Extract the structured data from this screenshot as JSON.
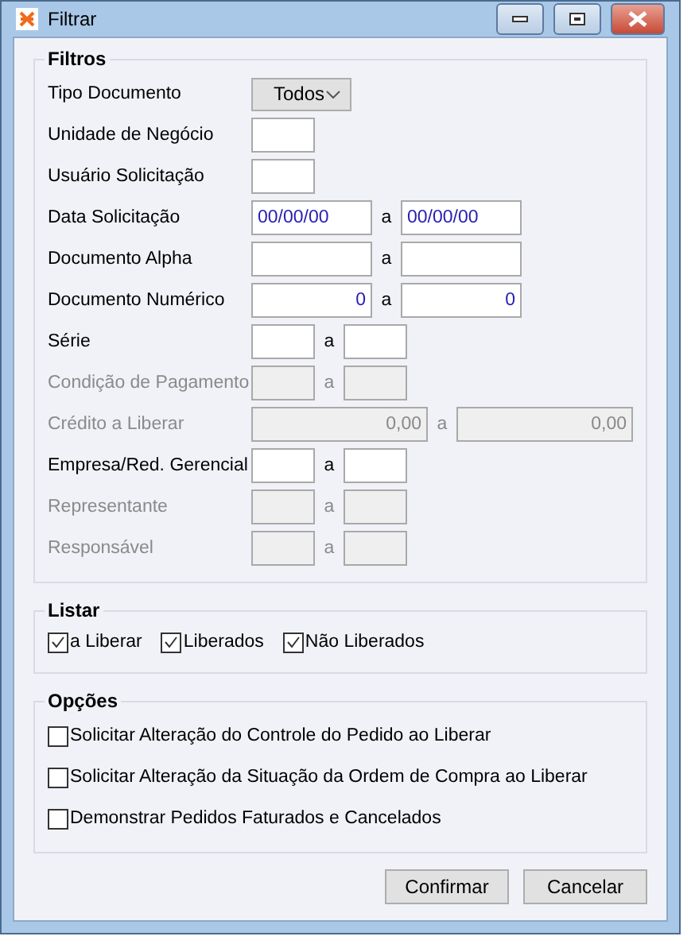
{
  "window": {
    "title": "Filtrar"
  },
  "filters": {
    "title": "Filtros",
    "rows": [
      {
        "label": "Tipo Documento",
        "kind": "select",
        "disabled": false,
        "value": "Todos"
      },
      {
        "label": "Unidade de Negócio",
        "kind": "code",
        "disabled": false
      },
      {
        "label": "Usuário Solicitação",
        "kind": "code",
        "disabled": false
      },
      {
        "label": "Data Solicitação",
        "kind": "dates",
        "disabled": false,
        "from": "00/00/00",
        "to": "00/00/00",
        "separator": "a"
      },
      {
        "label": "Documento Alpha",
        "kind": "texts",
        "disabled": false,
        "separator": "a"
      },
      {
        "label": "Documento Numérico",
        "kind": "numbers",
        "disabled": false,
        "from": "0",
        "to": "0",
        "separator": "a"
      },
      {
        "label": "Série",
        "kind": "codes",
        "disabled": false,
        "separator": "a"
      },
      {
        "label": "Condição de Pagamento",
        "kind": "codes",
        "disabled": true,
        "separator": "a"
      },
      {
        "label": "Crédito a Liberar",
        "kind": "amounts",
        "disabled": true,
        "from": "0,00",
        "to": "0,00",
        "separator": "a"
      },
      {
        "label": "Empresa/Red. Gerencial",
        "kind": "codes",
        "disabled": false,
        "separator": "a"
      },
      {
        "label": "Representante",
        "kind": "codes",
        "disabled": true,
        "separator": "a"
      },
      {
        "label": "Responsável",
        "kind": "codes",
        "disabled": true,
        "separator": "a"
      }
    ]
  },
  "list": {
    "title": "Listar",
    "items": [
      {
        "label": "a Liberar",
        "checked": true
      },
      {
        "label": "Liberados",
        "checked": true
      },
      {
        "label": "Não Liberados",
        "checked": true
      }
    ]
  },
  "options": {
    "title": "Opções",
    "items": [
      {
        "label": "Solicitar Alteração do Controle do Pedido ao Liberar",
        "checked": false
      },
      {
        "label": "Solicitar Alteração da Situação da Ordem de Compra ao Liberar",
        "checked": false
      },
      {
        "label": "Demonstrar Pedidos Faturados e Cancelados",
        "checked": false
      }
    ]
  },
  "buttons": [
    "Confirmar",
    "Cancelar"
  ]
}
